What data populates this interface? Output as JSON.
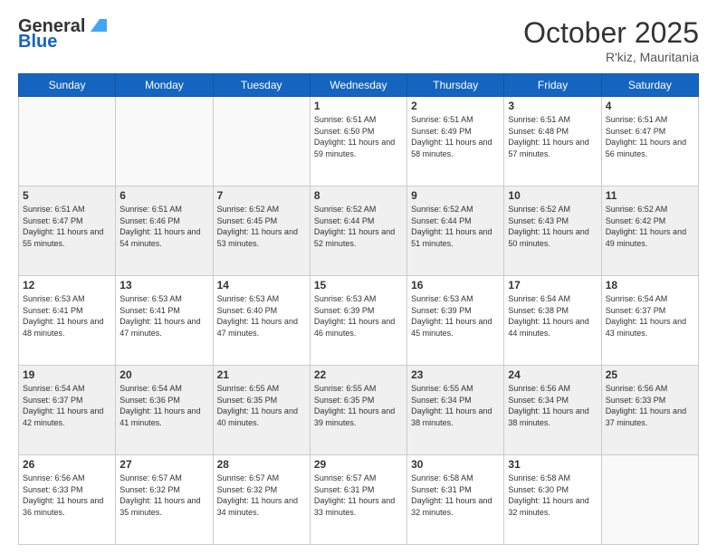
{
  "header": {
    "logo": {
      "general": "General",
      "blue": "Blue"
    },
    "title": "October 2025",
    "location": "R'kiz, Mauritania"
  },
  "days_of_week": [
    "Sunday",
    "Monday",
    "Tuesday",
    "Wednesday",
    "Thursday",
    "Friday",
    "Saturday"
  ],
  "weeks": [
    [
      {
        "day": "",
        "info": ""
      },
      {
        "day": "",
        "info": ""
      },
      {
        "day": "",
        "info": ""
      },
      {
        "day": "1",
        "info": "Sunrise: 6:51 AM\nSunset: 6:50 PM\nDaylight: 11 hours and 59 minutes."
      },
      {
        "day": "2",
        "info": "Sunrise: 6:51 AM\nSunset: 6:49 PM\nDaylight: 11 hours and 58 minutes."
      },
      {
        "day": "3",
        "info": "Sunrise: 6:51 AM\nSunset: 6:48 PM\nDaylight: 11 hours and 57 minutes."
      },
      {
        "day": "4",
        "info": "Sunrise: 6:51 AM\nSunset: 6:47 PM\nDaylight: 11 hours and 56 minutes."
      }
    ],
    [
      {
        "day": "5",
        "info": "Sunrise: 6:51 AM\nSunset: 6:47 PM\nDaylight: 11 hours and 55 minutes."
      },
      {
        "day": "6",
        "info": "Sunrise: 6:51 AM\nSunset: 6:46 PM\nDaylight: 11 hours and 54 minutes."
      },
      {
        "day": "7",
        "info": "Sunrise: 6:52 AM\nSunset: 6:45 PM\nDaylight: 11 hours and 53 minutes."
      },
      {
        "day": "8",
        "info": "Sunrise: 6:52 AM\nSunset: 6:44 PM\nDaylight: 11 hours and 52 minutes."
      },
      {
        "day": "9",
        "info": "Sunrise: 6:52 AM\nSunset: 6:44 PM\nDaylight: 11 hours and 51 minutes."
      },
      {
        "day": "10",
        "info": "Sunrise: 6:52 AM\nSunset: 6:43 PM\nDaylight: 11 hours and 50 minutes."
      },
      {
        "day": "11",
        "info": "Sunrise: 6:52 AM\nSunset: 6:42 PM\nDaylight: 11 hours and 49 minutes."
      }
    ],
    [
      {
        "day": "12",
        "info": "Sunrise: 6:53 AM\nSunset: 6:41 PM\nDaylight: 11 hours and 48 minutes."
      },
      {
        "day": "13",
        "info": "Sunrise: 6:53 AM\nSunset: 6:41 PM\nDaylight: 11 hours and 47 minutes."
      },
      {
        "day": "14",
        "info": "Sunrise: 6:53 AM\nSunset: 6:40 PM\nDaylight: 11 hours and 47 minutes."
      },
      {
        "day": "15",
        "info": "Sunrise: 6:53 AM\nSunset: 6:39 PM\nDaylight: 11 hours and 46 minutes."
      },
      {
        "day": "16",
        "info": "Sunrise: 6:53 AM\nSunset: 6:39 PM\nDaylight: 11 hours and 45 minutes."
      },
      {
        "day": "17",
        "info": "Sunrise: 6:54 AM\nSunset: 6:38 PM\nDaylight: 11 hours and 44 minutes."
      },
      {
        "day": "18",
        "info": "Sunrise: 6:54 AM\nSunset: 6:37 PM\nDaylight: 11 hours and 43 minutes."
      }
    ],
    [
      {
        "day": "19",
        "info": "Sunrise: 6:54 AM\nSunset: 6:37 PM\nDaylight: 11 hours and 42 minutes."
      },
      {
        "day": "20",
        "info": "Sunrise: 6:54 AM\nSunset: 6:36 PM\nDaylight: 11 hours and 41 minutes."
      },
      {
        "day": "21",
        "info": "Sunrise: 6:55 AM\nSunset: 6:35 PM\nDaylight: 11 hours and 40 minutes."
      },
      {
        "day": "22",
        "info": "Sunrise: 6:55 AM\nSunset: 6:35 PM\nDaylight: 11 hours and 39 minutes."
      },
      {
        "day": "23",
        "info": "Sunrise: 6:55 AM\nSunset: 6:34 PM\nDaylight: 11 hours and 38 minutes."
      },
      {
        "day": "24",
        "info": "Sunrise: 6:56 AM\nSunset: 6:34 PM\nDaylight: 11 hours and 38 minutes."
      },
      {
        "day": "25",
        "info": "Sunrise: 6:56 AM\nSunset: 6:33 PM\nDaylight: 11 hours and 37 minutes."
      }
    ],
    [
      {
        "day": "26",
        "info": "Sunrise: 6:56 AM\nSunset: 6:33 PM\nDaylight: 11 hours and 36 minutes."
      },
      {
        "day": "27",
        "info": "Sunrise: 6:57 AM\nSunset: 6:32 PM\nDaylight: 11 hours and 35 minutes."
      },
      {
        "day": "28",
        "info": "Sunrise: 6:57 AM\nSunset: 6:32 PM\nDaylight: 11 hours and 34 minutes."
      },
      {
        "day": "29",
        "info": "Sunrise: 6:57 AM\nSunset: 6:31 PM\nDaylight: 11 hours and 33 minutes."
      },
      {
        "day": "30",
        "info": "Sunrise: 6:58 AM\nSunset: 6:31 PM\nDaylight: 11 hours and 32 minutes."
      },
      {
        "day": "31",
        "info": "Sunrise: 6:58 AM\nSunset: 6:30 PM\nDaylight: 11 hours and 32 minutes."
      },
      {
        "day": "",
        "info": ""
      }
    ]
  ]
}
